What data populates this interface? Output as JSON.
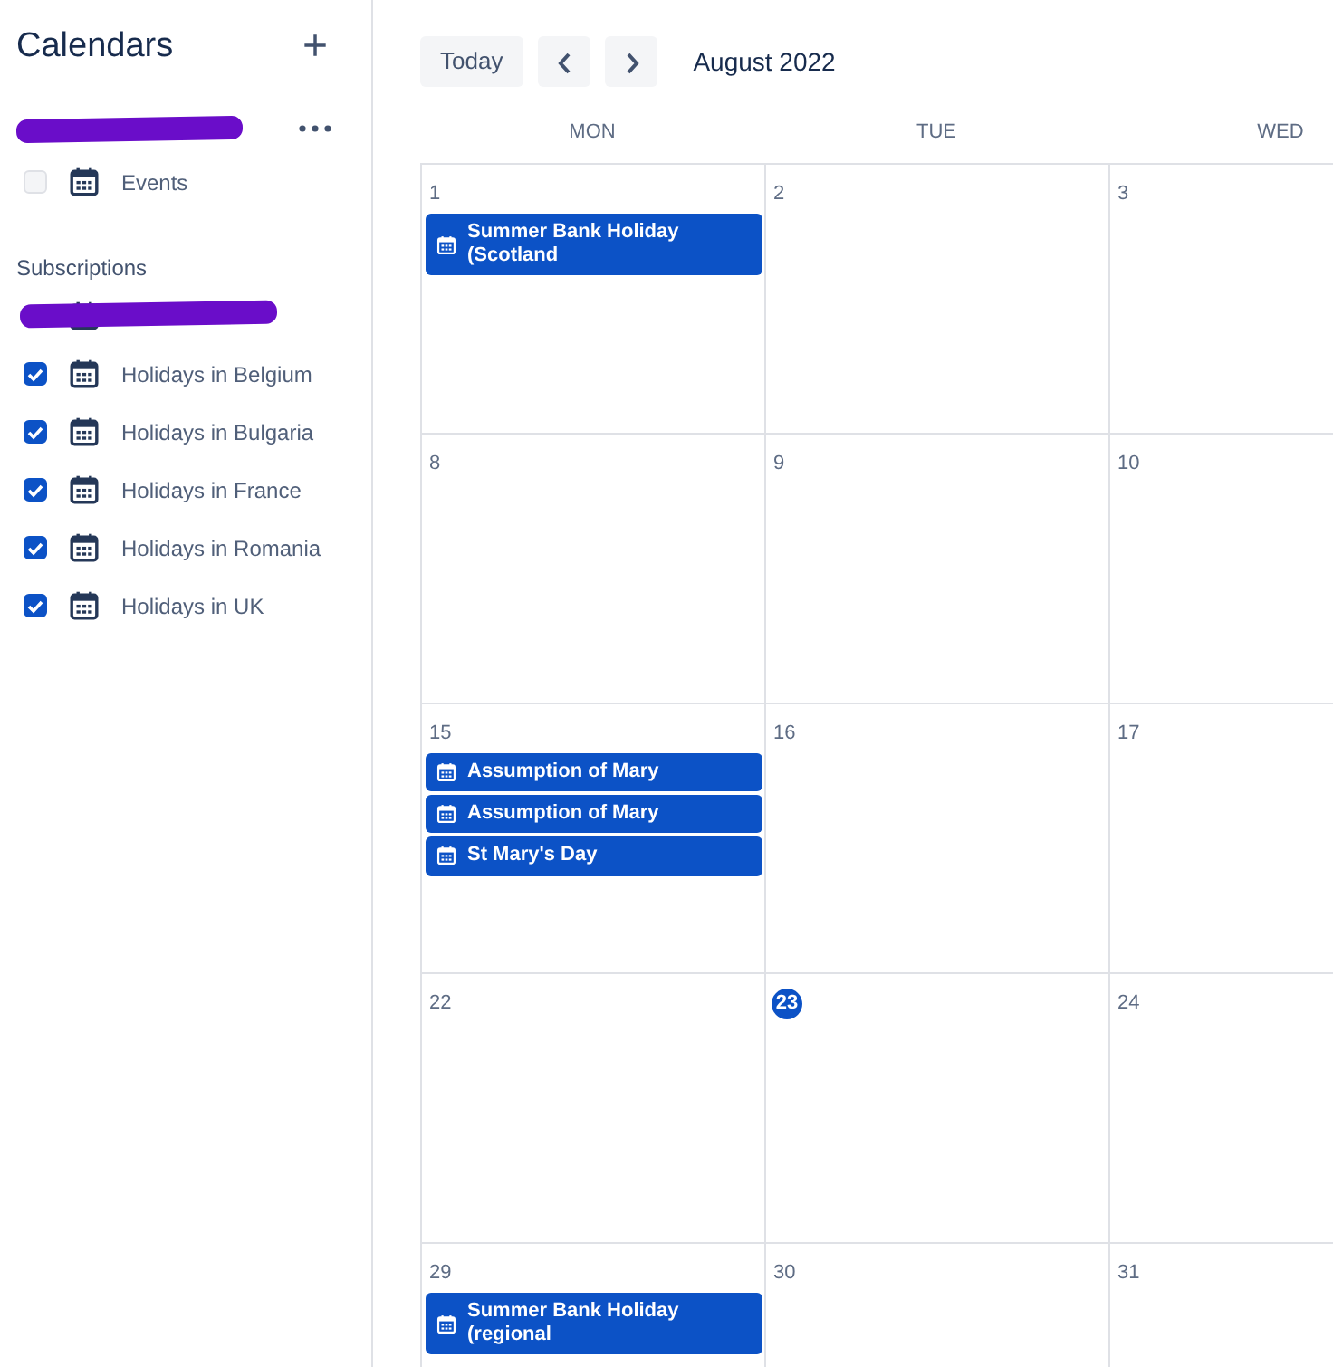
{
  "sidebar": {
    "title": "Calendars",
    "add_button": "+",
    "groups": [
      {
        "title_redacted": true,
        "has_menu": true,
        "items": [
          {
            "label": "Events",
            "checked": false
          }
        ]
      },
      {
        "title": "Subscriptions",
        "items": [
          {
            "redacted": true
          },
          {
            "label": "Holidays in Belgium",
            "checked": true
          },
          {
            "label": "Holidays in Bulgaria",
            "checked": true
          },
          {
            "label": "Holidays in France",
            "checked": true
          },
          {
            "label": "Holidays in Romania",
            "checked": true
          },
          {
            "label": "Holidays in UK",
            "checked": true
          }
        ]
      }
    ]
  },
  "toolbar": {
    "today_button": "Today",
    "period": "August 2022"
  },
  "calendar": {
    "columns": [
      "MON",
      "TUE",
      "WED"
    ],
    "weeks": [
      [
        {
          "day": "1",
          "today": false,
          "events": [
            "Summer Bank Holiday (Scotland"
          ]
        },
        {
          "day": "2",
          "today": false
        },
        {
          "day": "3",
          "today": false
        }
      ],
      [
        {
          "day": "8",
          "today": false
        },
        {
          "day": "9",
          "today": false
        },
        {
          "day": "10",
          "today": false
        }
      ],
      [
        {
          "day": "15",
          "today": false,
          "events": [
            "Assumption of Mary",
            "Assumption of Mary",
            "St Mary's Day"
          ]
        },
        {
          "day": "16",
          "today": false
        },
        {
          "day": "17",
          "today": false
        }
      ],
      [
        {
          "day": "22",
          "today": false
        },
        {
          "day": "23",
          "today": true
        },
        {
          "day": "24",
          "today": false
        }
      ],
      [
        {
          "day": "29",
          "today": false,
          "events": [
            "Summer Bank Holiday (regional"
          ]
        },
        {
          "day": "30",
          "today": false
        },
        {
          "day": "31",
          "today": false
        }
      ]
    ]
  }
}
